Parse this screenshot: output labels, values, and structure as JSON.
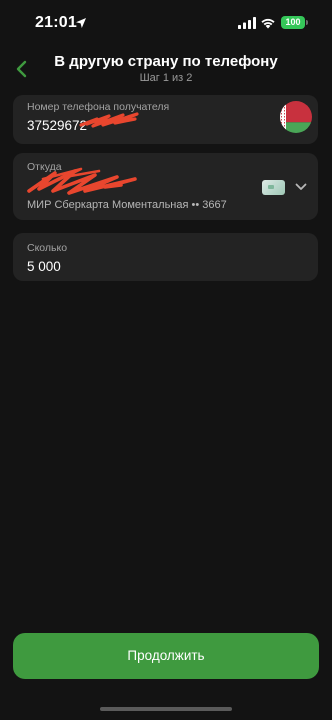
{
  "status_bar": {
    "time": "21:01",
    "battery": "100",
    "battery_color": "#35c759"
  },
  "header": {
    "title": "В другую страну по телефону",
    "subtitle": "Шаг 1 из 2",
    "back_icon": "chevron-left-icon"
  },
  "phone_field": {
    "label": "Номер телефона получателя",
    "value": "37529672",
    "country_icon": "belarus-flag-icon"
  },
  "from_field": {
    "label": "Откуда",
    "card_description": "МИР Сберкарта Моментальная •• 3667",
    "card_icon": "bank-card-icon",
    "expand_icon": "chevron-down-icon"
  },
  "amount_field": {
    "label": "Сколько",
    "value": "5 000"
  },
  "continue_button": {
    "label": "Продолжить",
    "color": "#3f9a3f"
  },
  "colors": {
    "accent": "#3f9a3f",
    "background": "#131313",
    "card": "#232323"
  }
}
